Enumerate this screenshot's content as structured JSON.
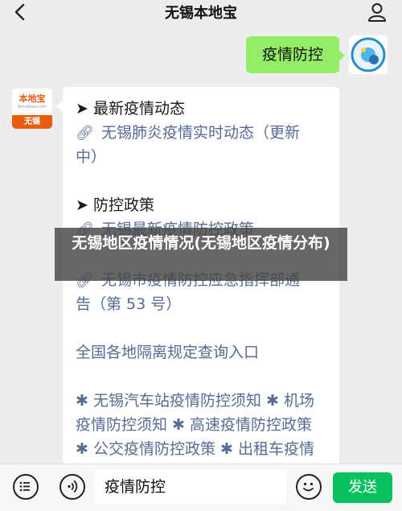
{
  "header": {
    "title": "无锡本地宝"
  },
  "user_message": {
    "text": "疫情防控"
  },
  "bot": {
    "avatar_logo": "本地宝",
    "avatar_domain": "Bendibao.com",
    "avatar_city": "无锡",
    "sections": [
      {
        "heading": "➤ 最新疫情动态",
        "links": [
          "无锡肺炎疫情实时动态（更新",
          "中）"
        ]
      },
      {
        "heading": "➤ 防控政策",
        "links": [
          "无锡最新疫情防控政策",
          "无锡市疫情防控应急指挥部通",
          "告（第 53 号）"
        ]
      }
    ],
    "query_link": "全国各地隔离规定查询入口",
    "notice_lines": [
      "✱ 无锡汽车站疫情防控须知 ✱ 机场",
      "疫情防控须知 ✱ 高速疫情防控政策",
      "✱ 公交疫情防控政策 ✱ 出租车疫情"
    ]
  },
  "overlay": {
    "text": "无锡地区疫情情况(无锡地区疫情分布)"
  },
  "input": {
    "value": "疫情防控"
  },
  "buttons": {
    "send": "发送"
  }
}
